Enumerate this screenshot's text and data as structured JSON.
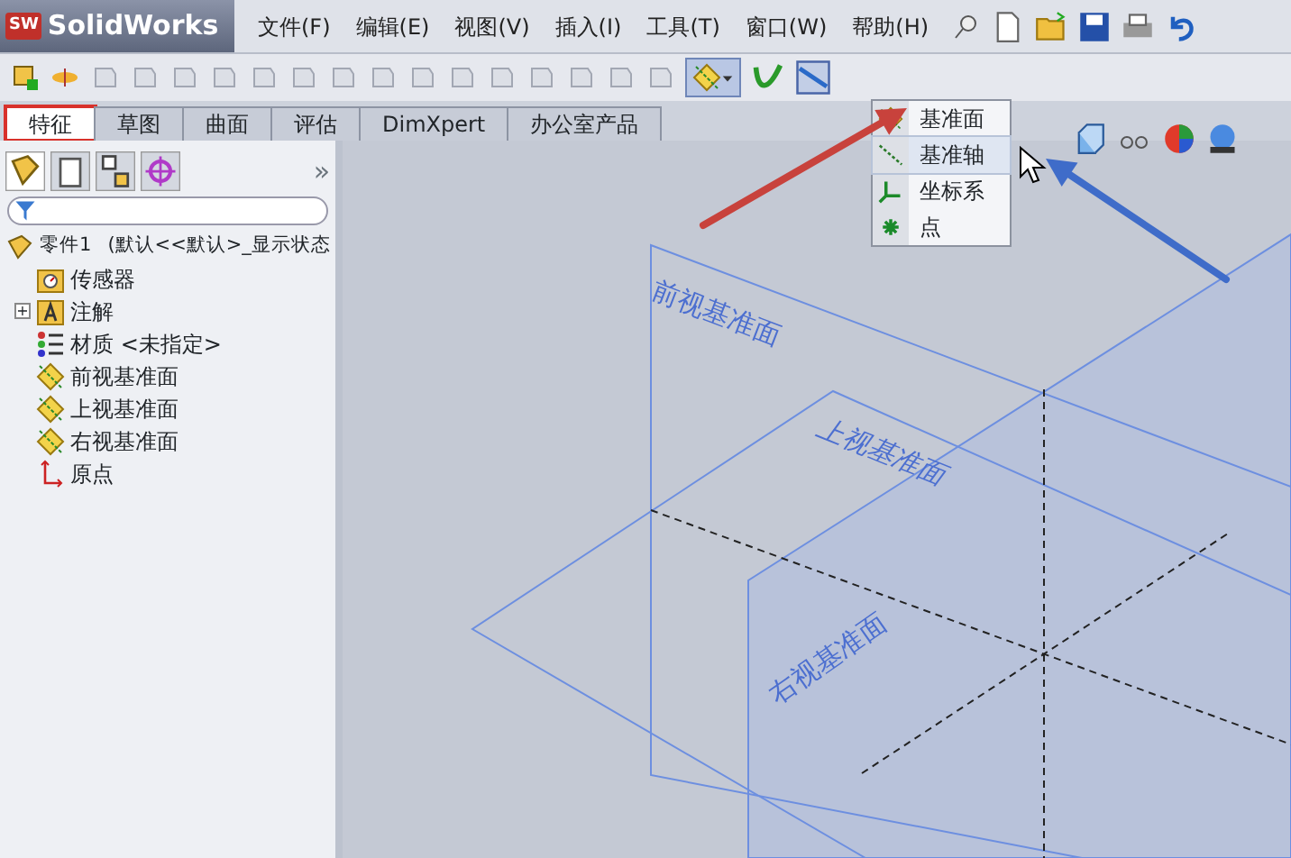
{
  "app": {
    "brand_badge": "SW",
    "brand": "SolidWorks"
  },
  "menu": [
    "文件(F)",
    "编辑(E)",
    "视图(V)",
    "插入(I)",
    "工具(T)",
    "窗口(W)",
    "帮助(H)"
  ],
  "reference_geometry_button": {
    "expanded": true
  },
  "tabs": [
    {
      "label": "特征",
      "selected": true,
      "highlighted": true
    },
    {
      "label": "草图",
      "selected": false,
      "highlighted": false
    },
    {
      "label": "曲面",
      "selected": false,
      "highlighted": false
    },
    {
      "label": "评估",
      "selected": false,
      "highlighted": false
    },
    {
      "label": "DimXpert",
      "selected": false,
      "highlighted": false
    },
    {
      "label": "办公室产品",
      "selected": false,
      "highlighted": false
    }
  ],
  "panel": {
    "more": "»",
    "tree": {
      "name": "零件1",
      "config": "(默认<<默认>_显示状态",
      "children": [
        {
          "kind": "sensor",
          "label": "传感器"
        },
        {
          "kind": "annotation",
          "label": "注解",
          "toggle": "+",
          "expanded": false
        },
        {
          "kind": "material",
          "label": "材质 <未指定>"
        },
        {
          "kind": "plane",
          "label": "前视基准面"
        },
        {
          "kind": "plane",
          "label": "上视基准面"
        },
        {
          "kind": "plane",
          "label": "右视基准面"
        },
        {
          "kind": "origin",
          "label": "原点"
        }
      ]
    }
  },
  "dropdown": [
    {
      "kind": "plane",
      "label": "基准面",
      "selected": false
    },
    {
      "kind": "axis",
      "label": "基准轴",
      "selected": true
    },
    {
      "kind": "coordinate",
      "label": "坐标系",
      "selected": false
    },
    {
      "kind": "point",
      "label": "点",
      "selected": false
    }
  ],
  "viewport": {
    "plane_labels": [
      "前视基准面",
      "上视基准面",
      "右视基准面"
    ]
  },
  "annotations": [
    {
      "kind": "arrow",
      "color": "#c8423c"
    },
    {
      "kind": "arrow",
      "color": "#3f6cc9"
    }
  ]
}
